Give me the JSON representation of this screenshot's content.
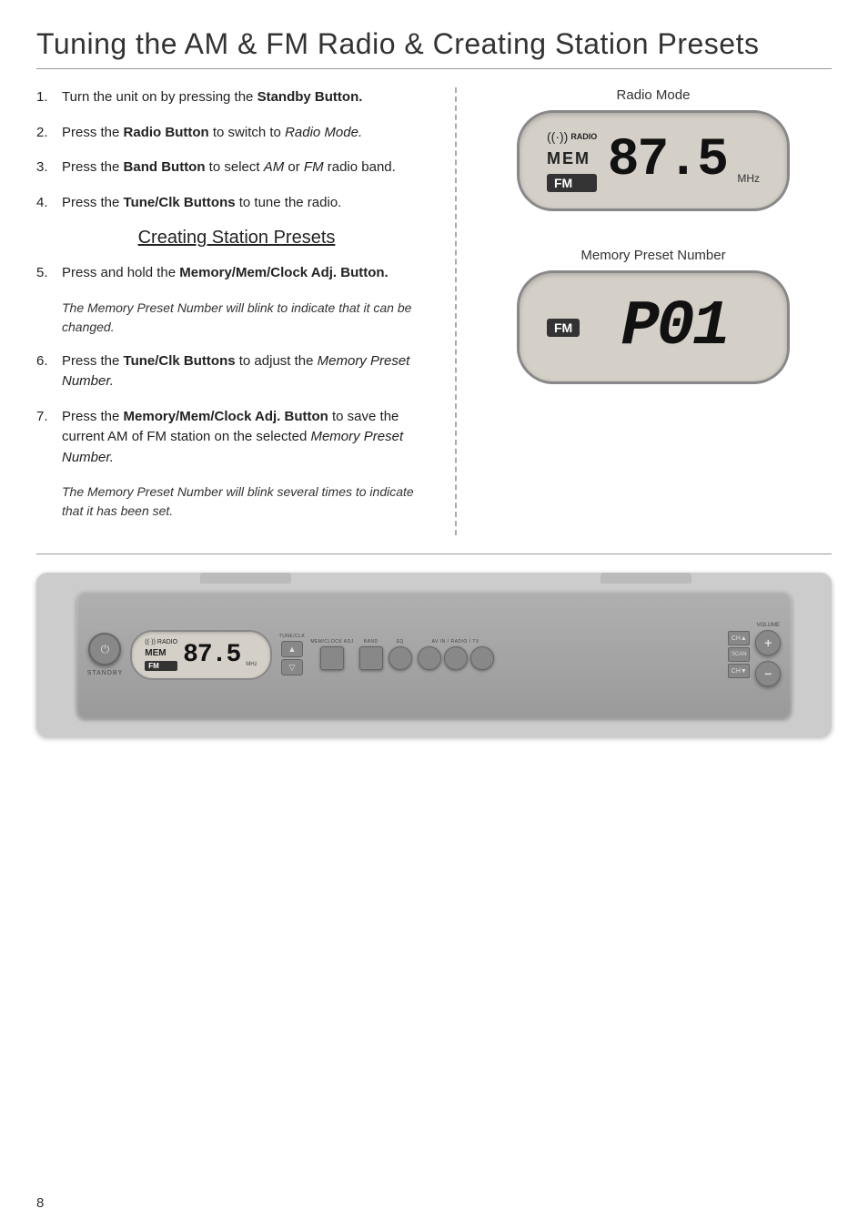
{
  "page": {
    "title": "Tuning the AM & FM Radio & Creating Station Presets",
    "page_number": "8"
  },
  "instructions": {
    "step1": {
      "num": "1.",
      "text_plain": "Turn the unit on by pressing the ",
      "text_bold": "Standby Button."
    },
    "step2": {
      "num": "2.",
      "text_plain": "Press the ",
      "text_bold": "Radio Button",
      "text_plain2": " to switch to ",
      "text_italic": "Radio Mode."
    },
    "step3": {
      "num": "3.",
      "text_plain": "Press the ",
      "text_bold": "Band Button",
      "text_plain2": " to select ",
      "text_italic": "AM",
      "text_plain3": " or ",
      "text_italic2": "FM",
      "text_plain4": " radio band."
    },
    "step4": {
      "num": "4.",
      "text_plain": "Press the ",
      "text_bold": "Tune/Clk Buttons",
      "text_plain2": " to tune the radio."
    },
    "section_heading": "Creating Station Presets",
    "step5": {
      "num": "5.",
      "text_plain": "Press and hold the ",
      "text_bold": "Memory/Mem/Clock Adj. Button."
    },
    "note1": "The Memory Preset Number will blink to indicate that it can be changed.",
    "step6": {
      "num": "6.",
      "text_plain": "Press the ",
      "text_bold": "Tune/Clk Buttons",
      "text_plain2": " to adjust the ",
      "text_italic": "Memory Preset Number."
    },
    "step7": {
      "num": "7.",
      "text_plain": "Press the ",
      "text_bold": "Memory/Mem/Clock Adj. Button",
      "text_plain2": " to save the current AM of FM station on the selected ",
      "text_italic": "Memory Preset Number."
    },
    "note2": "The Memory Preset Number will blink several times to indicate that it has been set."
  },
  "diagrams": {
    "radio_mode": {
      "label": "Radio Mode",
      "icon_radio": "((·))",
      "icon_label": "RADIO",
      "mem_label": "MEM",
      "fm_badge": "FM",
      "frequency": "87.5",
      "mhz_label": "MHz"
    },
    "preset_mode": {
      "label": "Memory Preset Number",
      "fm_badge": "FM",
      "preset_number": "P01"
    }
  },
  "mini_display": {
    "radio_icon": "((·))",
    "radio_label": "RADIO",
    "mem_label": "MEM",
    "fm_badge": "FM",
    "frequency": "87.5",
    "mhz": "MHz"
  },
  "buttons": {
    "standby_label": "STANDBY",
    "volume_label": "VOLUME",
    "volume_plus": "+",
    "volume_minus": "−",
    "tune_up": "▲",
    "tune_down": "▽",
    "ch_up": "CH▲",
    "ch_mid": "SCAN",
    "ch_down": "CH▼"
  }
}
